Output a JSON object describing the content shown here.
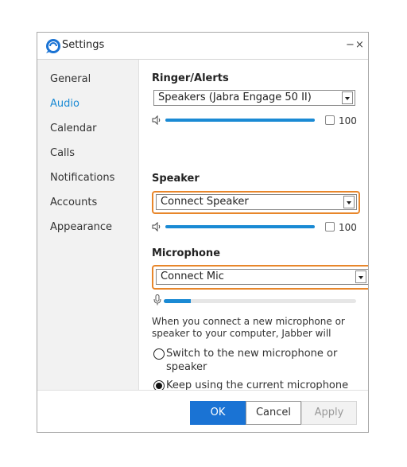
{
  "window": {
    "title": "Settings",
    "minimize_glyph": "−",
    "close_glyph": "×"
  },
  "sidebar": {
    "items": [
      {
        "label": "General",
        "active": false
      },
      {
        "label": "Audio",
        "active": true
      },
      {
        "label": "Calendar",
        "active": false
      },
      {
        "label": "Calls",
        "active": false
      },
      {
        "label": "Notifications",
        "active": false
      },
      {
        "label": "Accounts",
        "active": false
      },
      {
        "label": "Appearance",
        "active": false
      }
    ]
  },
  "audio": {
    "ringer": {
      "heading": "Ringer/Alerts",
      "device": "Speakers (Jabra Engage 50 II)",
      "volume": "100"
    },
    "speaker": {
      "heading": "Speaker",
      "device": "Connect Speaker",
      "volume": "100"
    },
    "microphone": {
      "heading": "Microphone",
      "device": "Connect Mic",
      "level_fraction": 0.14
    },
    "info_text": "When you connect a new microphone or speaker to your computer, Jabber will",
    "options": [
      {
        "label": "Switch to the new microphone or speaker",
        "checked": false
      },
      {
        "label": "Keep using the current microphone or speaker",
        "checked": true
      }
    ]
  },
  "footer": {
    "ok_label": "OK",
    "cancel_label": "Cancel",
    "apply_label": "Apply"
  },
  "colors": {
    "accent": "#1a8ad4",
    "highlight": "#e8862a",
    "ok_button": "#1a73d4"
  },
  "icons": {
    "app": "jabber-logo-icon",
    "speaker_volume": "speaker-volume-icon",
    "microphone": "microphone-icon"
  }
}
